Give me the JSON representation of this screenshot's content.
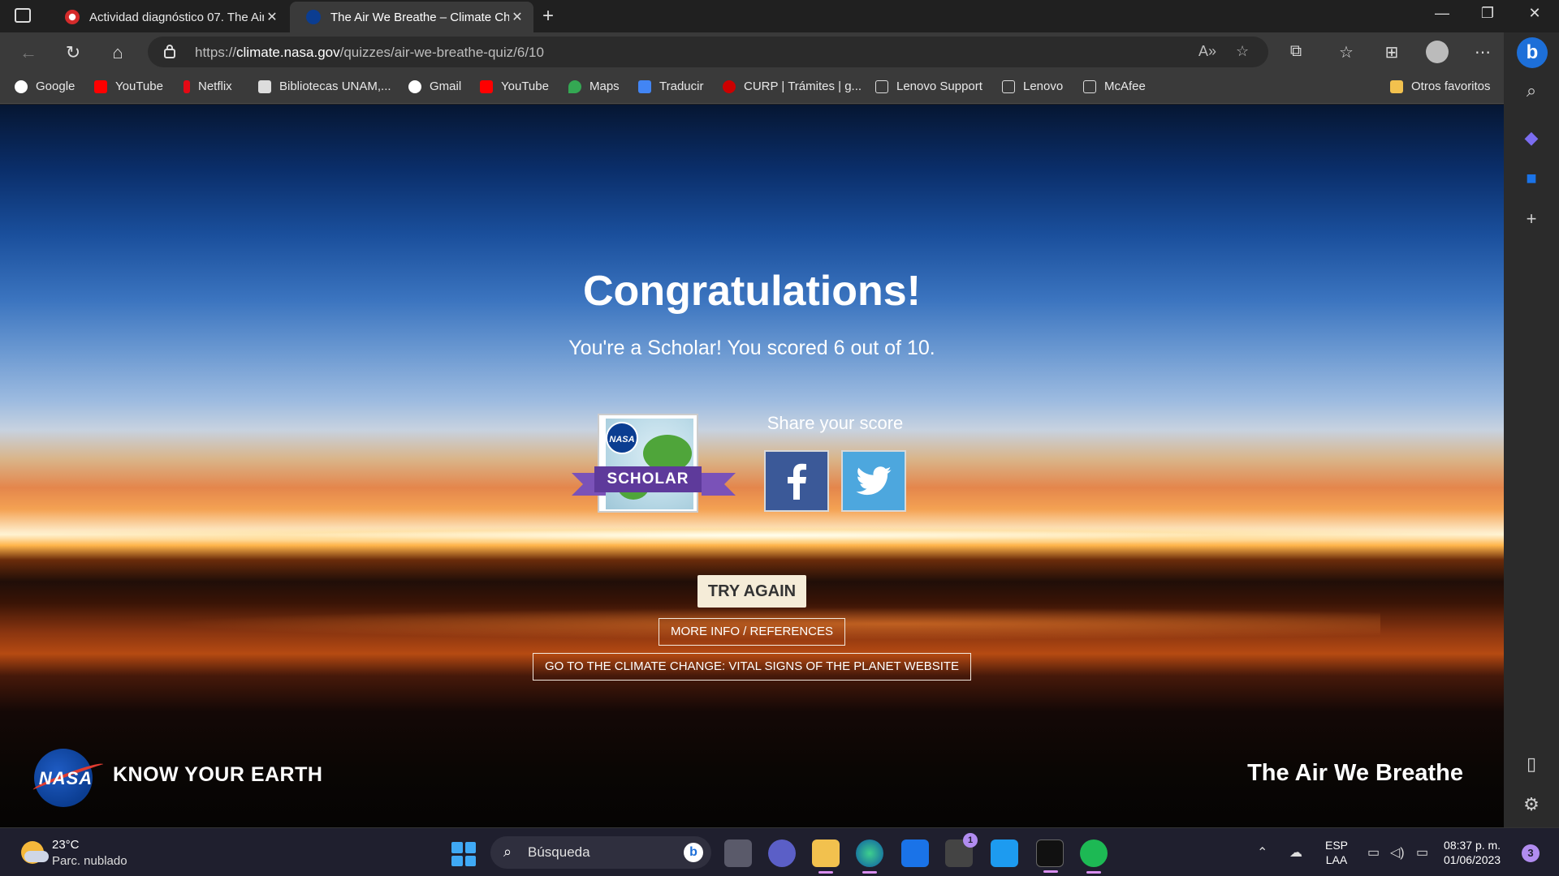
{
  "browser": {
    "tabs": [
      {
        "title": "Actividad diagnóstico 07. The Air",
        "active": false
      },
      {
        "title": "The Air We Breathe – Climate Ch",
        "active": true
      }
    ],
    "url_prefix": "https://",
    "url_domain": "climate.nasa.gov",
    "url_path": "/quizzes/air-we-breathe-quiz/6/10",
    "bookmarks": [
      "Google",
      "YouTube",
      "Netflix",
      "Bibliotecas UNAM,...",
      "Gmail",
      "YouTube",
      "Maps",
      "Traducir",
      "CURP | Trámites | g...",
      "Lenovo Support",
      "Lenovo",
      "McAfee"
    ],
    "other_favorites": "Otros favoritos"
  },
  "quiz": {
    "heading": "Congratulations!",
    "result": "You're a Scholar! You scored 6 out of 10.",
    "badge_label": "SCHOLAR",
    "badge_logo": "NASA",
    "share_label": "Share your score",
    "try_again": "TRY AGAIN",
    "more_info": "MORE INFO / REFERENCES",
    "vital_signs": "GO TO THE CLIMATE CHANGE: VITAL SIGNS OF THE PLANET WEBSITE",
    "footer_logo": "NASA",
    "footer_left": "KNOW YOUR EARTH",
    "footer_right": "The Air We Breathe"
  },
  "taskbar": {
    "temperature": "23°C",
    "condition": "Parc. nublado",
    "search_placeholder": "Búsqueda",
    "store_badge": "1",
    "language": "ESP",
    "layout": "LAA",
    "time": "08:37 p. m.",
    "date": "01/06/2023",
    "notifications": "3"
  },
  "colors": {
    "facebook": "#3b5998",
    "twitter": "#4da7de",
    "badge_ribbon": "#5e3a9b",
    "try_again_bg": "#f5ecd8"
  }
}
